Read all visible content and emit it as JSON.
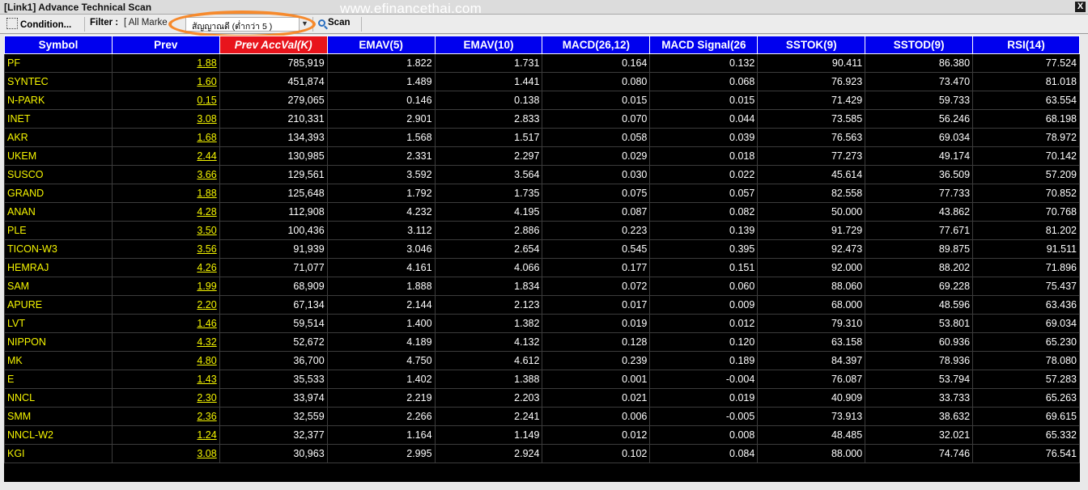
{
  "window": {
    "title": "[Link1] Advance Technical Scan",
    "watermark": "www.efinancethai.com",
    "close": "X"
  },
  "toolbar": {
    "condition_label": "Condition...",
    "filter_label": "Filter :",
    "filter_value": "[ All Marke",
    "signal_value": "สัญญาณดี (ต่ำกว่า 5 )",
    "scan_label": "Scan",
    "highlight_color": "#f68a2d"
  },
  "table": {
    "columns": [
      "Symbol",
      "Prev",
      "Prev AccVal(K)",
      "EMAV(5)",
      "EMAV(10)",
      "MACD(26,12)",
      "MACD Signal(26",
      "SSTOK(9)",
      "SSTOD(9)",
      "RSI(14)"
    ],
    "sorted_column": 2,
    "rows": [
      [
        "PF",
        "1.88",
        "785,919",
        "1.822",
        "1.731",
        "0.164",
        "0.132",
        "90.411",
        "86.380",
        "77.524"
      ],
      [
        "SYNTEC",
        "1.60",
        "451,874",
        "1.489",
        "1.441",
        "0.080",
        "0.068",
        "76.923",
        "73.470",
        "81.018"
      ],
      [
        "N-PARK",
        "0.15",
        "279,065",
        "0.146",
        "0.138",
        "0.015",
        "0.015",
        "71.429",
        "59.733",
        "63.554"
      ],
      [
        "INET",
        "3.08",
        "210,331",
        "2.901",
        "2.833",
        "0.070",
        "0.044",
        "73.585",
        "56.246",
        "68.198"
      ],
      [
        "AKR",
        "1.68",
        "134,393",
        "1.568",
        "1.517",
        "0.058",
        "0.039",
        "76.563",
        "69.034",
        "78.972"
      ],
      [
        "UKEM",
        "2.44",
        "130,985",
        "2.331",
        "2.297",
        "0.029",
        "0.018",
        "77.273",
        "49.174",
        "70.142"
      ],
      [
        "SUSCO",
        "3.66",
        "129,561",
        "3.592",
        "3.564",
        "0.030",
        "0.022",
        "45.614",
        "36.509",
        "57.209"
      ],
      [
        "GRAND",
        "1.88",
        "125,648",
        "1.792",
        "1.735",
        "0.075",
        "0.057",
        "82.558",
        "77.733",
        "70.852"
      ],
      [
        "ANAN",
        "4.28",
        "112,908",
        "4.232",
        "4.195",
        "0.087",
        "0.082",
        "50.000",
        "43.862",
        "70.768"
      ],
      [
        "PLE",
        "3.50",
        "100,436",
        "3.112",
        "2.886",
        "0.223",
        "0.139",
        "91.729",
        "77.671",
        "81.202"
      ],
      [
        "TICON-W3",
        "3.56",
        "91,939",
        "3.046",
        "2.654",
        "0.545",
        "0.395",
        "92.473",
        "89.875",
        "91.511"
      ],
      [
        "HEMRAJ",
        "4.26",
        "71,077",
        "4.161",
        "4.066",
        "0.177",
        "0.151",
        "92.000",
        "88.202",
        "71.896"
      ],
      [
        "SAM",
        "1.99",
        "68,909",
        "1.888",
        "1.834",
        "0.072",
        "0.060",
        "88.060",
        "69.228",
        "75.437"
      ],
      [
        "APURE",
        "2.20",
        "67,134",
        "2.144",
        "2.123",
        "0.017",
        "0.009",
        "68.000",
        "48.596",
        "63.436"
      ],
      [
        "LVT",
        "1.46",
        "59,514",
        "1.400",
        "1.382",
        "0.019",
        "0.012",
        "79.310",
        "53.801",
        "69.034"
      ],
      [
        "NIPPON",
        "4.32",
        "52,672",
        "4.189",
        "4.132",
        "0.128",
        "0.120",
        "63.158",
        "60.936",
        "65.230"
      ],
      [
        "MK",
        "4.80",
        "36,700",
        "4.750",
        "4.612",
        "0.239",
        "0.189",
        "84.397",
        "78.936",
        "78.080"
      ],
      [
        "E",
        "1.43",
        "35,533",
        "1.402",
        "1.388",
        "0.001",
        "-0.004",
        "76.087",
        "53.794",
        "57.283"
      ],
      [
        "NNCL",
        "2.30",
        "33,974",
        "2.219",
        "2.203",
        "0.021",
        "0.019",
        "40.909",
        "33.733",
        "65.263"
      ],
      [
        "SMM",
        "2.36",
        "32,559",
        "2.266",
        "2.241",
        "0.006",
        "-0.005",
        "73.913",
        "38.632",
        "69.615"
      ],
      [
        "NNCL-W2",
        "1.24",
        "32,377",
        "1.164",
        "1.149",
        "0.012",
        "0.008",
        "48.485",
        "32.021",
        "65.332"
      ],
      [
        "KGI",
        "3.08",
        "30,963",
        "2.995",
        "2.924",
        "0.102",
        "0.084",
        "88.000",
        "74.746",
        "76.541"
      ]
    ]
  },
  "colors": {
    "header_bg": "#0000ee",
    "sorted_header_bg": "#e8141c",
    "grid_bg": "#000000",
    "symbol_text": "#f5f500",
    "value_text": "#ffffff"
  }
}
